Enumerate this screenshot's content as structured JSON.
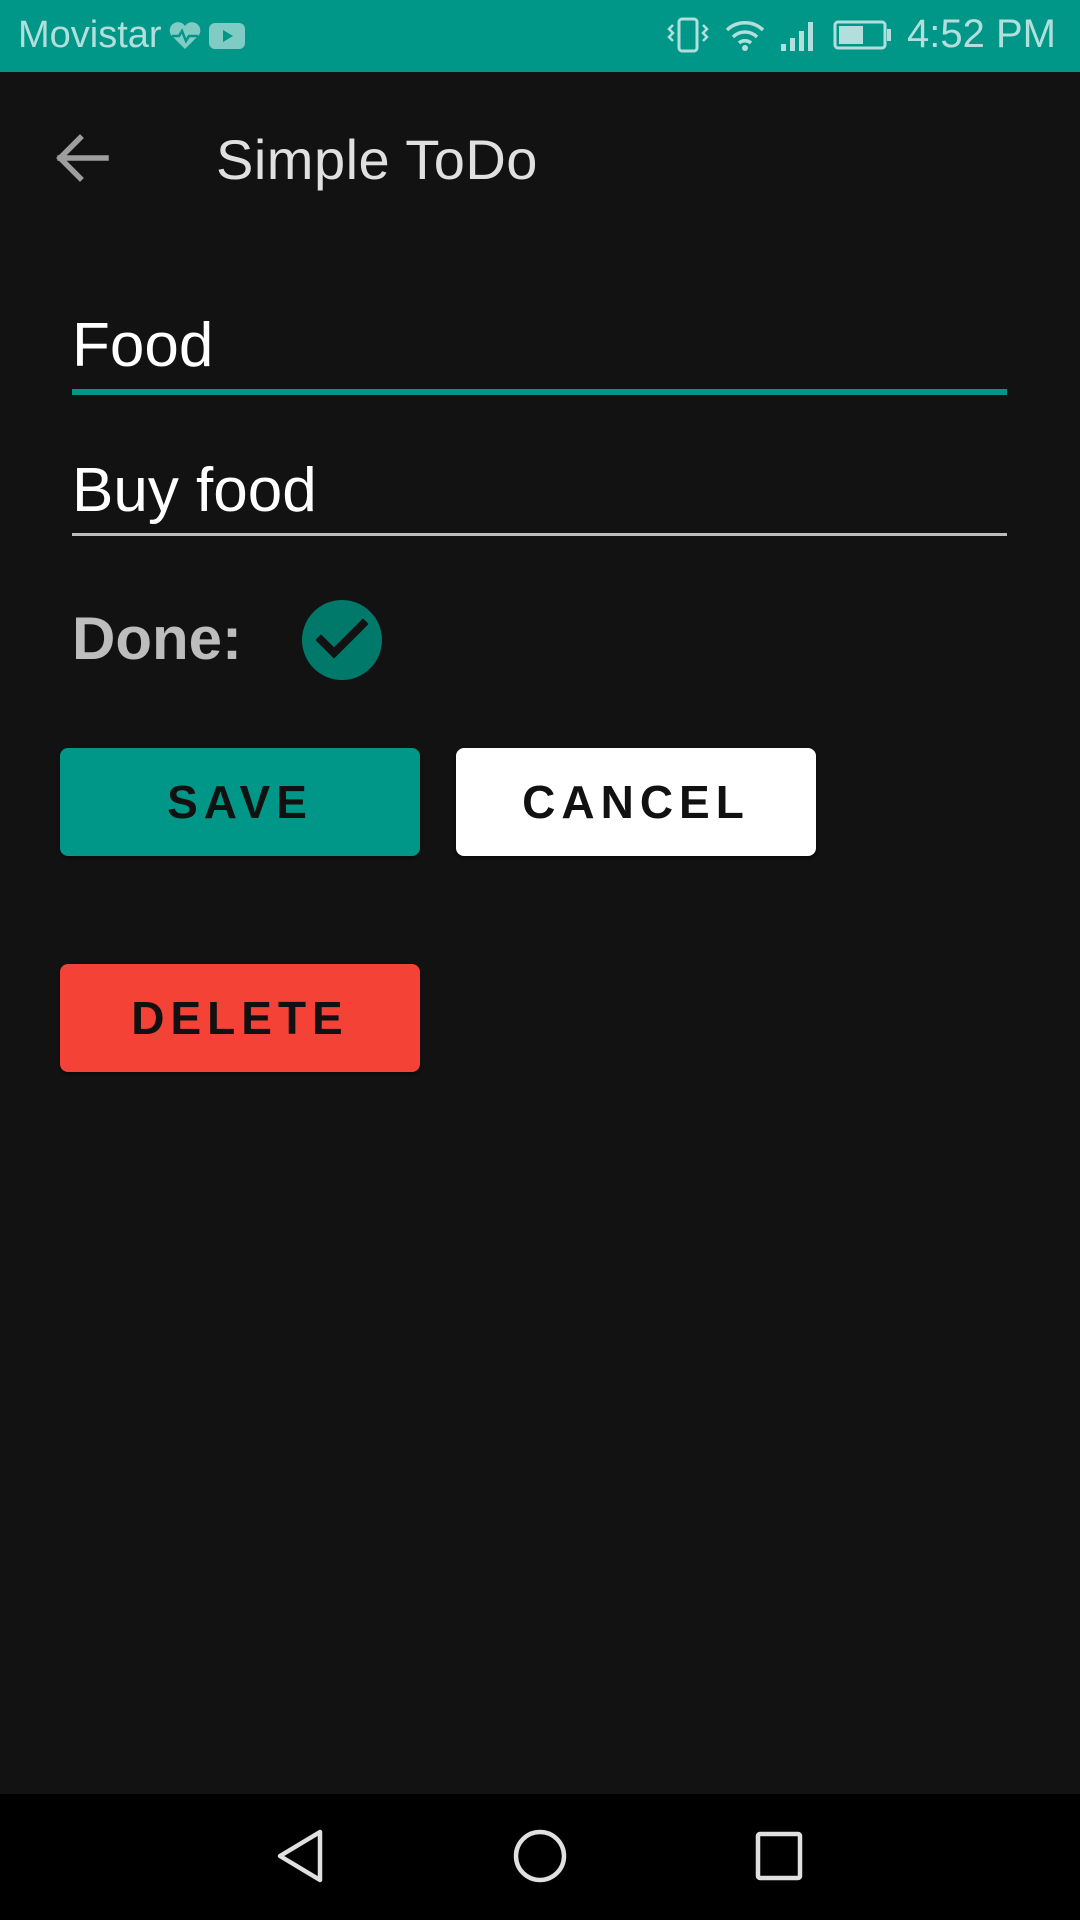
{
  "status_bar": {
    "carrier": "Movistar",
    "time": "4:52 PM",
    "icons": [
      "heart-rate-icon",
      "youtube-icon",
      "vibrate-icon",
      "wifi-icon",
      "signal-icon",
      "battery-icon"
    ]
  },
  "app_bar": {
    "title": "Simple ToDo",
    "back_icon": "arrow-back-icon"
  },
  "form": {
    "title_value": "Food",
    "description_value": "Buy food",
    "done_label": "Done:",
    "done_checked": true
  },
  "buttons": {
    "save": "SAVE",
    "cancel": "CANCEL",
    "delete": "DELETE"
  },
  "nav_bar": {
    "icons": [
      "nav-back-icon",
      "nav-home-icon",
      "nav-recents-icon"
    ]
  },
  "colors": {
    "accent": "#009688",
    "check_bg": "#00796b",
    "delete": "#f44336",
    "background": "#121212"
  }
}
